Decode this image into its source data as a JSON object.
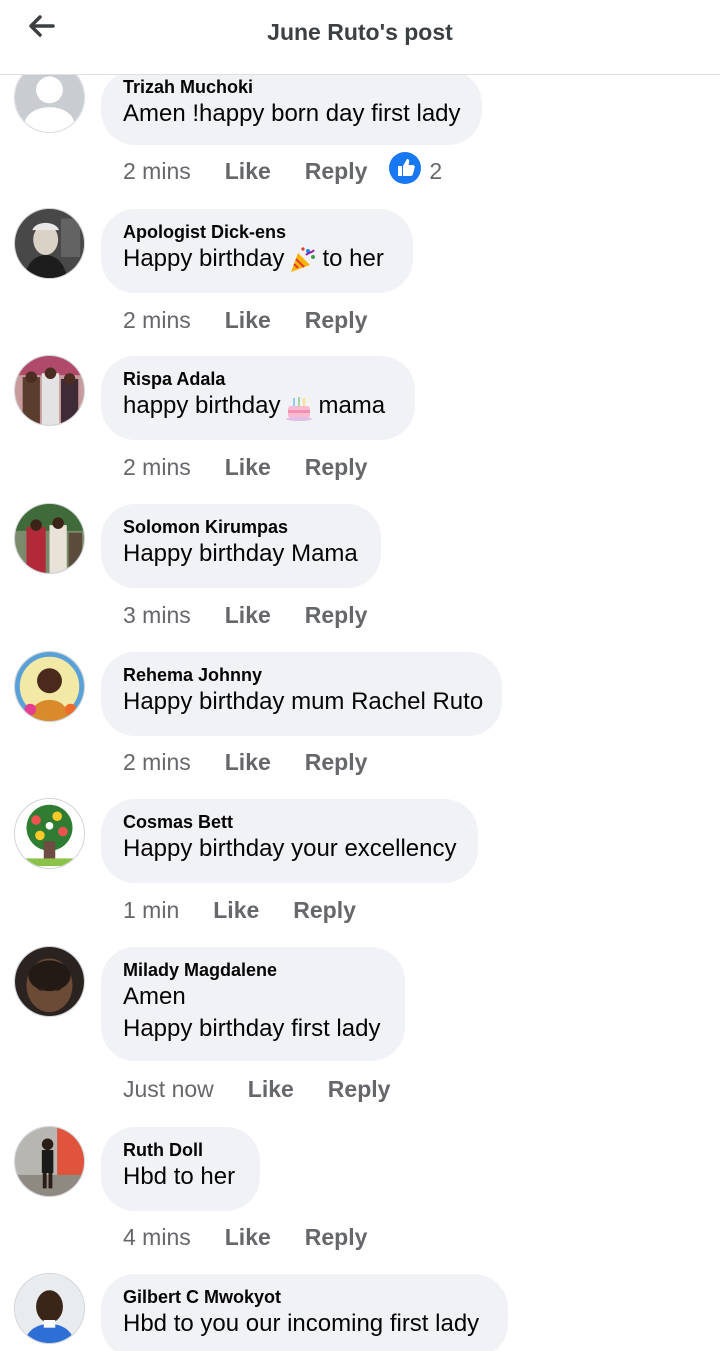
{
  "header": {
    "title": "June Ruto's post"
  },
  "actions": {
    "like_label": "Like",
    "reply_label": "Reply"
  },
  "colors": {
    "bubble": "#f0f2f5",
    "secondary_text": "#65676b",
    "like_blue": "#1877f2"
  },
  "comments": [
    {
      "author": "Trizah Muchoki",
      "lines": [
        "Amen !happy born day first lady"
      ],
      "time": "2 mins",
      "reactions": {
        "icon": "thumbs-up-icon",
        "count": "2"
      },
      "avatar": "default-avatar"
    },
    {
      "author": "Apologist Dick-ens",
      "text_before": "Happy birthday",
      "emoji": "party-popper-emoji",
      "text_after": "to her",
      "time": "2 mins",
      "avatar": "photo"
    },
    {
      "author": "Rispa Adala",
      "text_before": "happy birthday",
      "emoji": "birthday-cake-emoji",
      "text_after": "mama",
      "time": "2 mins",
      "avatar": "photo"
    },
    {
      "author": "Solomon Kirumpas",
      "lines": [
        "Happy birthday Mama"
      ],
      "time": "3 mins",
      "avatar": "photo"
    },
    {
      "author": "Rehema Johnny",
      "lines": [
        "Happy birthday mum Rachel Ruto"
      ],
      "time": "2 mins",
      "avatar": "photo"
    },
    {
      "author": "Cosmas Bett",
      "lines": [
        "Happy birthday your excellency"
      ],
      "time": "1 min",
      "avatar": "photo"
    },
    {
      "author": "Milady Magdalene",
      "lines": [
        "Amen",
        "Happy birthday first lady"
      ],
      "time": "Just now",
      "avatar": "photo"
    },
    {
      "author": "Ruth Doll",
      "lines": [
        "Hbd to her"
      ],
      "time": "4 mins",
      "avatar": "photo"
    },
    {
      "author": "Gilbert C Mwokyot",
      "lines": [
        "Hbd to you our incoming first lady"
      ],
      "time": "",
      "avatar": "photo"
    }
  ]
}
